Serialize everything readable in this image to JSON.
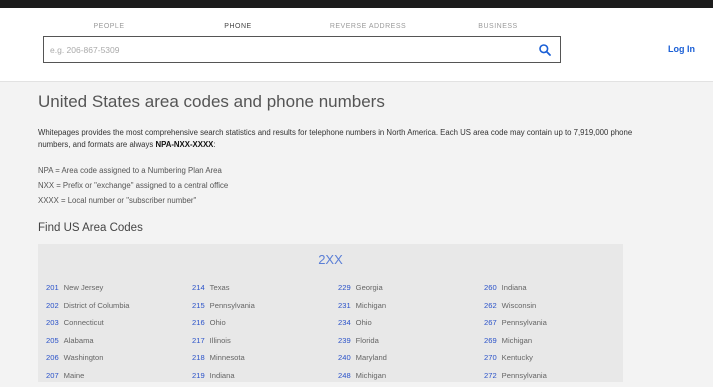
{
  "header": {
    "tabs": [
      {
        "label": "PEOPLE"
      },
      {
        "label": "PHONE"
      },
      {
        "label": "REVERSE ADDRESS"
      },
      {
        "label": "BUSINESS"
      }
    ],
    "search": {
      "placeholder": "e.g. 206-867-5309",
      "value": ""
    },
    "login_label": "Log In"
  },
  "main": {
    "title": "United States area codes and phone numbers",
    "intro_text": "Whitepages provides the most comprehensive search statistics and results for telephone numbers in North America. Each US area code may contain up to 7,919,000 phone numbers, and formats are always ",
    "intro_format": "NPA-NXX-XXXX",
    "intro_colon": ":",
    "definitions": [
      "NPA = Area code assigned to a Numbering Plan Area",
      "NXX = Prefix or \"exchange\" assigned to a central office",
      "XXXX = Local number or \"subscriber number\""
    ],
    "section_title": "Find US Area Codes",
    "group_title": "2XX",
    "columns": [
      [
        {
          "code": "201",
          "name": "New Jersey"
        },
        {
          "code": "202",
          "name": "District of Columbia"
        },
        {
          "code": "203",
          "name": "Connecticut"
        },
        {
          "code": "205",
          "name": "Alabama"
        },
        {
          "code": "206",
          "name": "Washington"
        },
        {
          "code": "207",
          "name": "Maine"
        }
      ],
      [
        {
          "code": "214",
          "name": "Texas"
        },
        {
          "code": "215",
          "name": "Pennsylvania"
        },
        {
          "code": "216",
          "name": "Ohio"
        },
        {
          "code": "217",
          "name": "Illinois"
        },
        {
          "code": "218",
          "name": "Minnesota"
        },
        {
          "code": "219",
          "name": "Indiana"
        }
      ],
      [
        {
          "code": "229",
          "name": "Georgia"
        },
        {
          "code": "231",
          "name": "Michigan"
        },
        {
          "code": "234",
          "name": "Ohio"
        },
        {
          "code": "239",
          "name": "Florida"
        },
        {
          "code": "240",
          "name": "Maryland"
        },
        {
          "code": "248",
          "name": "Michigan"
        }
      ],
      [
        {
          "code": "260",
          "name": "Indiana"
        },
        {
          "code": "262",
          "name": "Wisconsin"
        },
        {
          "code": "267",
          "name": "Pennsylvania"
        },
        {
          "code": "269",
          "name": "Michigan"
        },
        {
          "code": "270",
          "name": "Kentucky"
        },
        {
          "code": "272",
          "name": "Pennsylvania"
        }
      ]
    ]
  },
  "colors": {
    "accent": "#1a5fd6",
    "link": "#2a52c9",
    "panel": "#e8e8e8"
  },
  "icons": {
    "search": "search-icon"
  }
}
